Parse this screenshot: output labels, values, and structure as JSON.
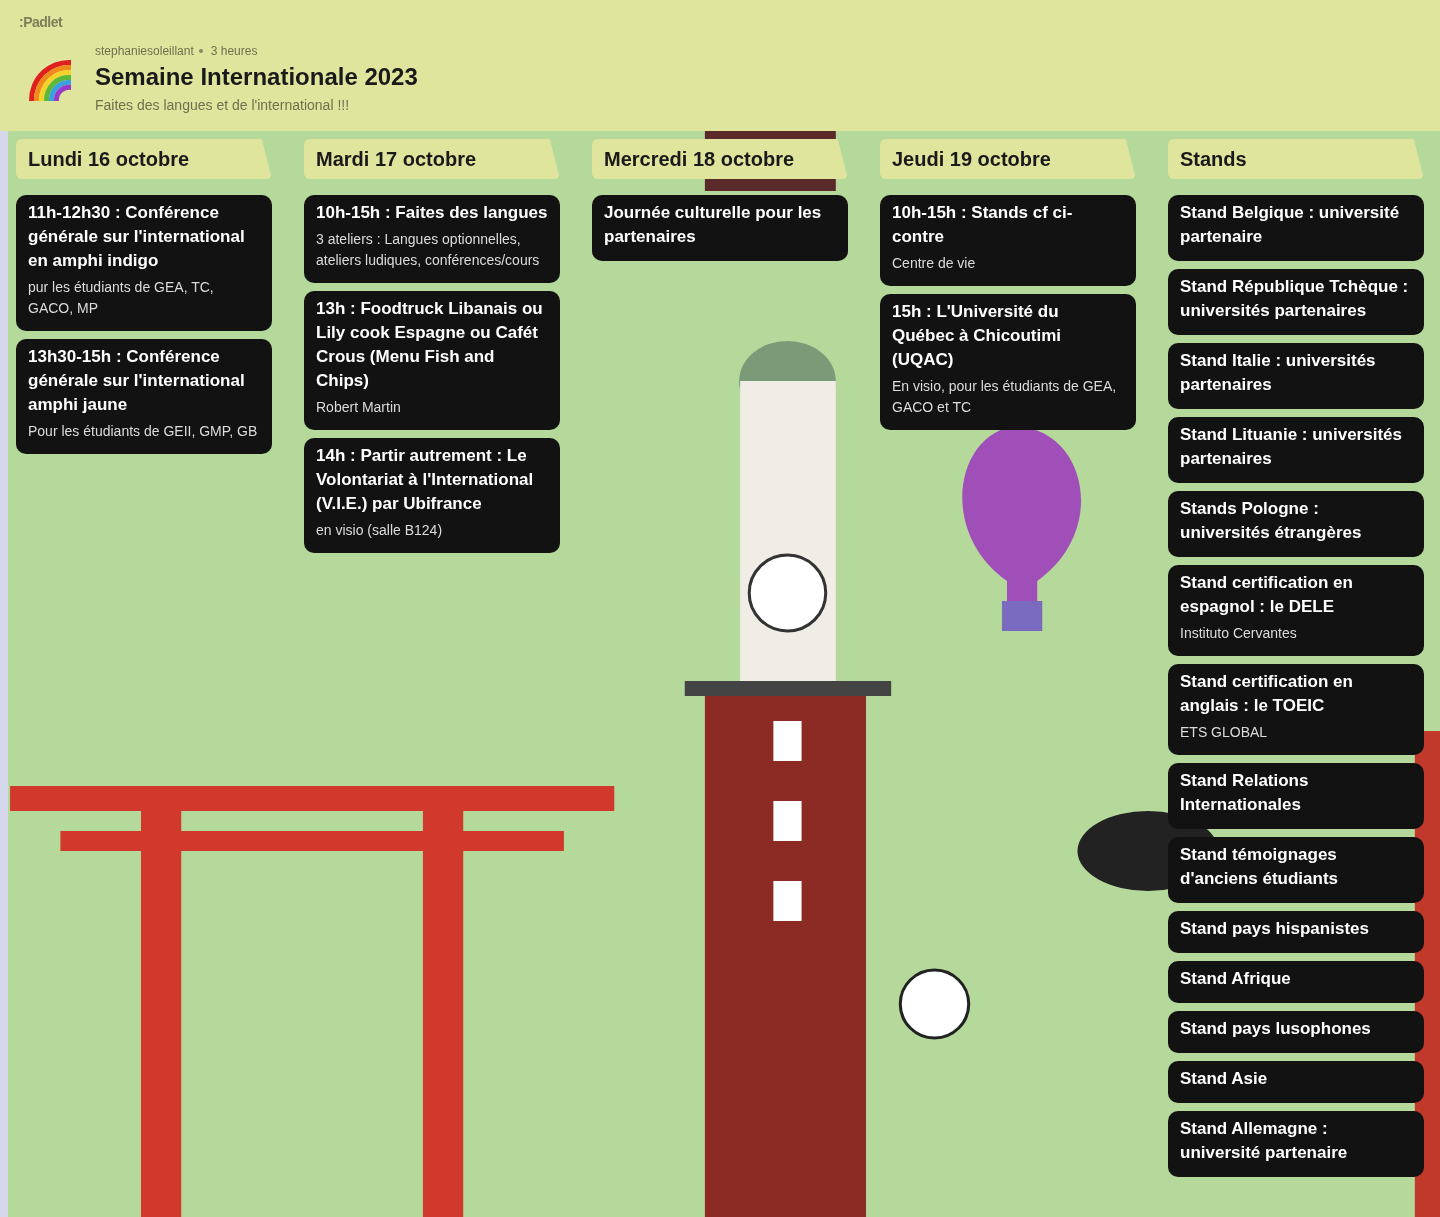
{
  "brand": ":Padlet",
  "board": {
    "author": "stephaniesoleillant",
    "time": "3 heures",
    "title": "Semaine Internationale 2023",
    "description": "Faites des langues et de l'international !!!"
  },
  "columns": [
    {
      "title": "Lundi 16 octobre",
      "posts": [
        {
          "title": "11h-12h30 : Conférence générale sur l'international en amphi indigo",
          "body": "pur les étudiants de GEA, TC, GACO, MP"
        },
        {
          "title": "13h30-15h : Conférence générale sur l'international amphi jaune",
          "body": "Pour les étudiants de GEII, GMP, GB"
        }
      ]
    },
    {
      "title": "Mardi 17 octobre",
      "posts": [
        {
          "title": "10h-15h : Faites des langues",
          "body": "3 ateliers : Langues optionnelles, ateliers ludiques, conférences/cours"
        },
        {
          "title": "13h : Foodtruck Libanais ou Lily cook Espagne ou Cafét Crous (Menu Fish and Chips)",
          "body": "Robert Martin"
        },
        {
          "title": "14h : Partir autrement : Le Volontariat à l'International (V.I.E.) par Ubifrance",
          "body": "en visio (salle B124)"
        }
      ]
    },
    {
      "title": "Mercredi 18 octobre",
      "posts": [
        {
          "title": "Journée culturelle pour les partenaires"
        }
      ]
    },
    {
      "title": "Jeudi 19 octobre",
      "posts": [
        {
          "title": "10h-15h : Stands cf ci-contre",
          "body": "Centre de vie"
        },
        {
          "title": "15h : L'Université du Québec à Chicoutimi (UQAC)",
          "body": "En visio, pour les étudiants de GEA, GACO et TC"
        }
      ]
    },
    {
      "title": "Stands",
      "posts": [
        {
          "title": "Stand Belgique : université partenaire"
        },
        {
          "title": "Stand République Tchèque : universités partenaires"
        },
        {
          "title": "Stand Italie : universités partenaires"
        },
        {
          "title": "Stand Lituanie : universités partenaires"
        },
        {
          "title": "Stands Pologne : universités étrangères"
        },
        {
          "title": "Stand certification en espagnol : le DELE",
          "body": "Instituto Cervantes"
        },
        {
          "title": "Stand certification en anglais : le TOEIC",
          "body": "ETS GLOBAL"
        },
        {
          "title": "Stand Relations Internationales"
        },
        {
          "title": "Stand témoignages d'anciens étudiants"
        },
        {
          "title": "Stand pays hispanistes"
        },
        {
          "title": "Stand Afrique"
        },
        {
          "title": "Stand pays lusophones"
        },
        {
          "title": "Stand Asie"
        },
        {
          "title": "Stand Allemagne : université partenaire"
        }
      ]
    }
  ]
}
